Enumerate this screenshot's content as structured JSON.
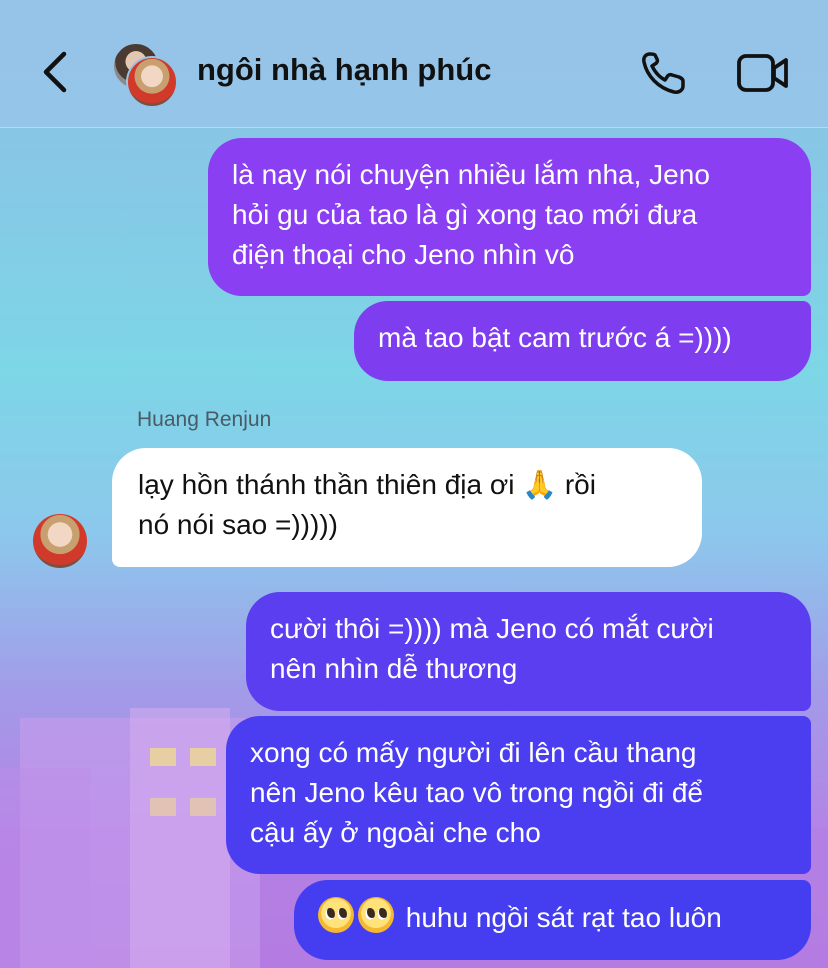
{
  "header": {
    "title": "ngôi nhà hạnh phúc",
    "back_icon": "chevron-left-icon",
    "call_icon": "phone-icon",
    "video_icon": "video-camera-icon"
  },
  "messages": [
    {
      "from": "me",
      "text": "là nay nói chuyện nhiều lắm nha, Jeno\nhỏi gu của tao là gì xong tao mới đưa\nđiện thoại cho Jeno nhìn vô"
    },
    {
      "from": "me",
      "text": "mà tao bật cam trước á =))))"
    },
    {
      "from": "Huang Renjun",
      "sender_name": "Huang Renjun",
      "text": "lạy hồn thánh thần thiên địa ơi 🙏 rồi\nnó nói sao =)))))"
    },
    {
      "from": "me",
      "text": "cười thôi =)))) mà Jeno có mắt cười\nnên nhìn dễ thương"
    },
    {
      "from": "me",
      "text": "xong có mấy người đi lên cầu thang\nnên Jeno kêu tao vô trong ngồi đi để\ncậu ấy ở ngoài che cho"
    },
    {
      "from": "me",
      "text": "huhu ngồi sát rạt tao luôn",
      "emojis": [
        "pleading-face",
        "pleading-face"
      ]
    }
  ],
  "colors": {
    "header_bg": "#96c4e8",
    "outgoing_top": "#8a3ff2",
    "outgoing_bottom": "#443ef0",
    "incoming_bg": "#ffffff"
  }
}
